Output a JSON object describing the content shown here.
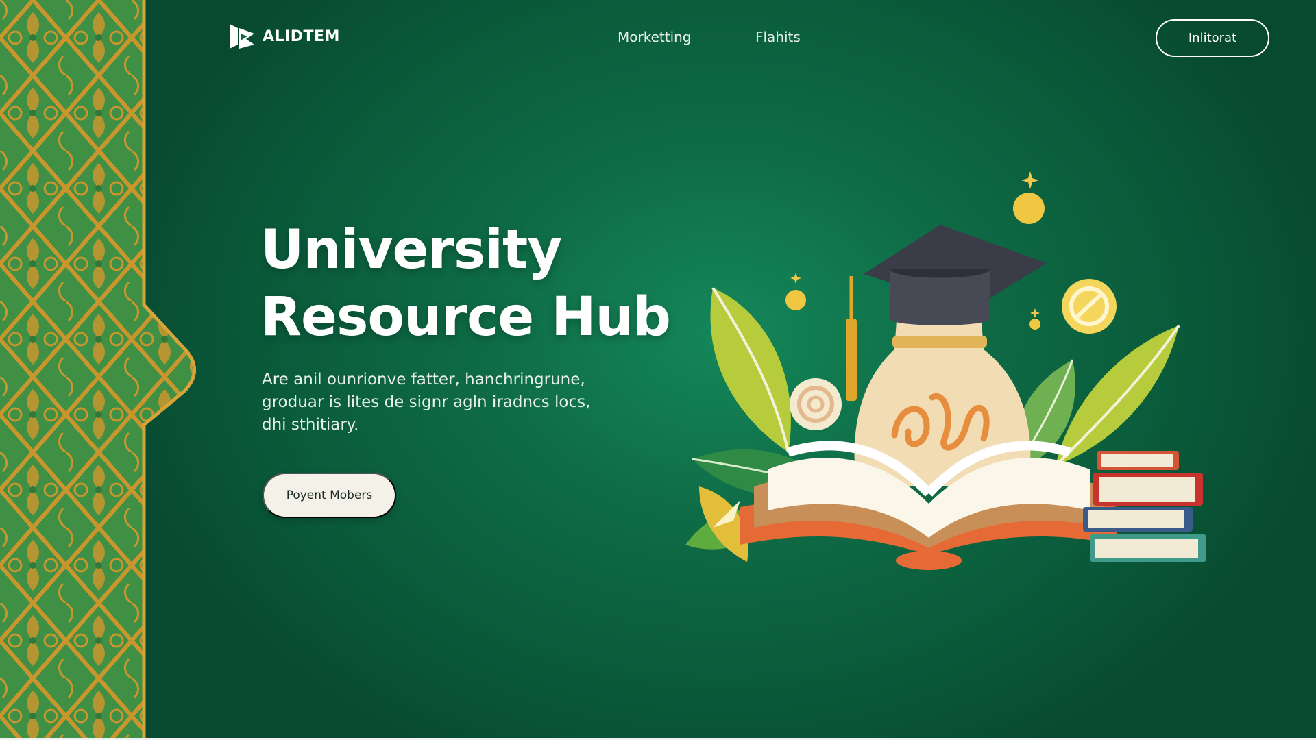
{
  "nav": {
    "logo_text": "ALIDTEM",
    "links": [
      "Morketting",
      "Flahits"
    ],
    "button_label": "Inlitorat"
  },
  "hero": {
    "title_line1": "University",
    "title_line2": "Resource Hub",
    "description_line1": "Are anil ounrionve fatter, hanchringrune,",
    "description_line2": "groduar is lites de signr agln iradncs locs,",
    "description_line3": "dhi sthitiary.",
    "cta_label": "Poyent Mobers"
  },
  "colors": {
    "background": "#0e6b45",
    "pattern_green": "#3f8f45",
    "pattern_gold": "#c9962e",
    "button_light": "#f3f1e8"
  },
  "icons": [
    "logo-icon",
    "graduation-cap-icon",
    "book-icon"
  ]
}
